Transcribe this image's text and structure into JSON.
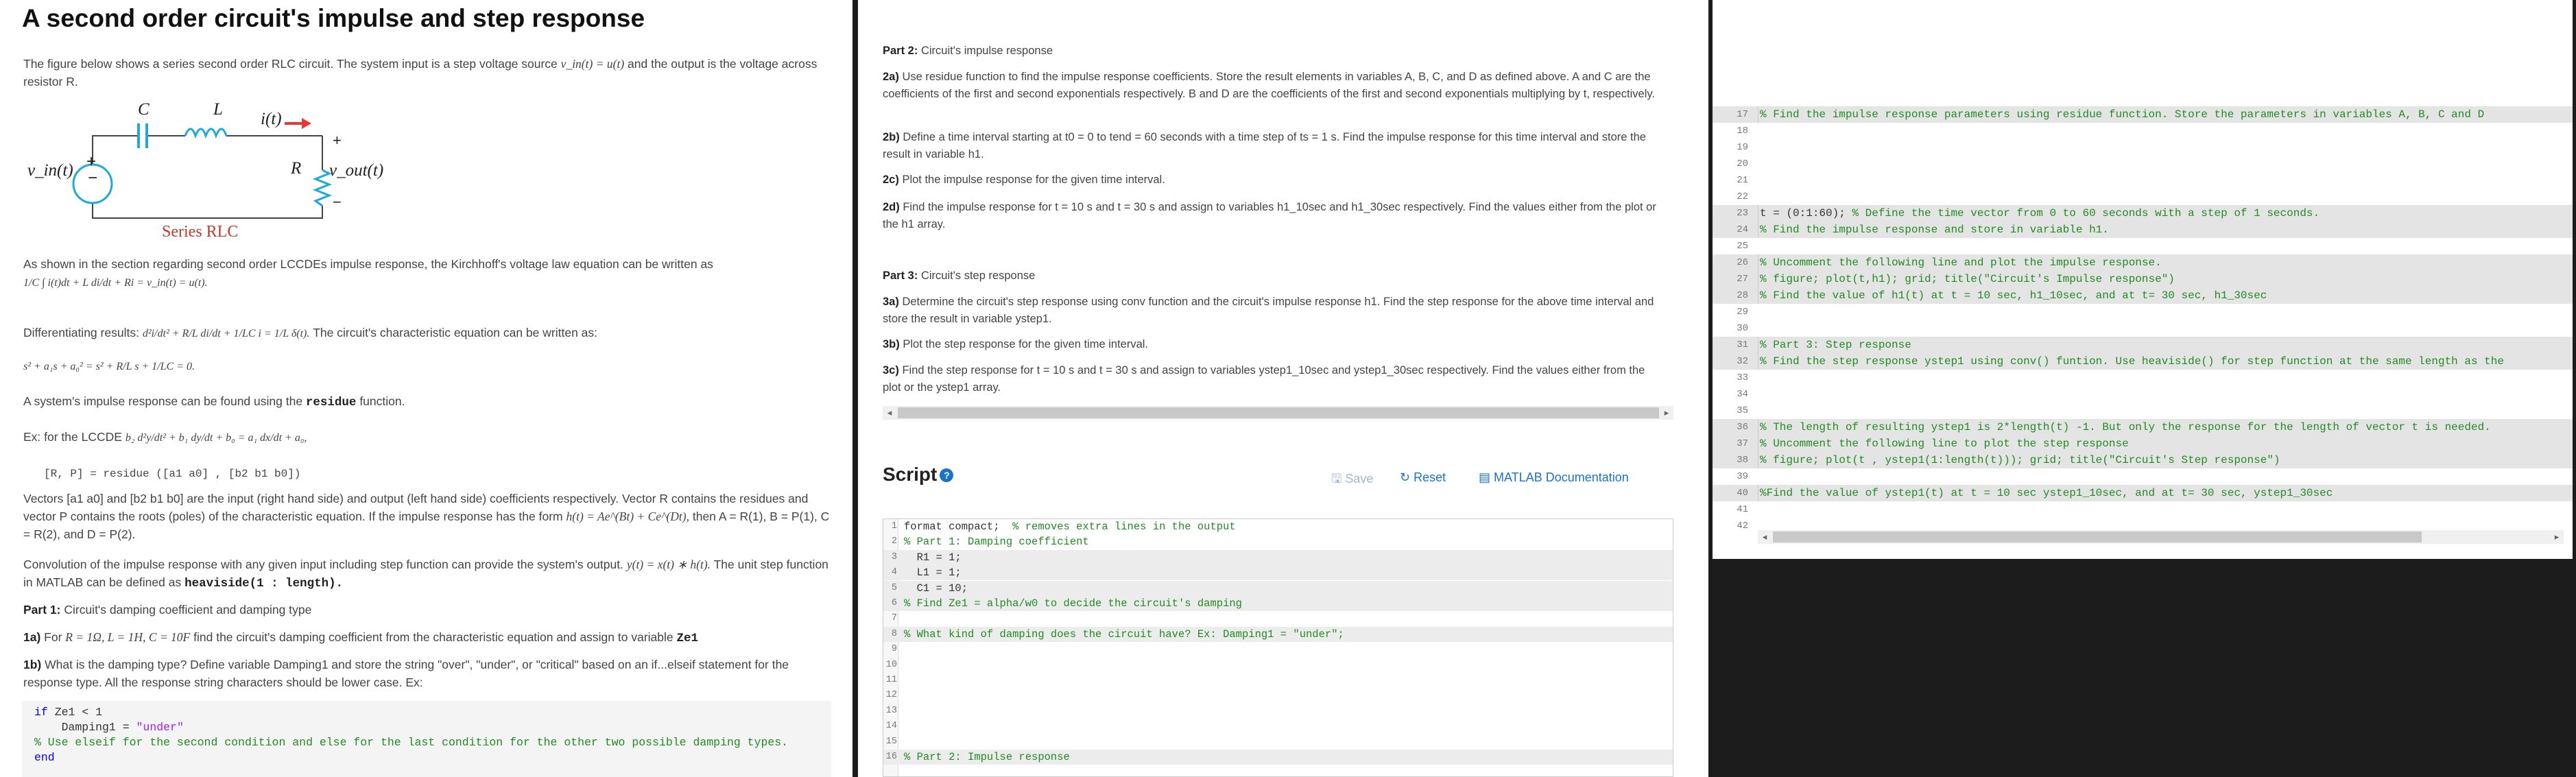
{
  "left": {
    "title": "A second order circuit's impulse and step response",
    "intro": "The figure below shows a series second order RLC circuit. The system input is a step voltage source",
    "intro_math": "v_in(t) = u(t)",
    "intro_tail": "and the output is the voltage across resistor R.",
    "circuit": {
      "C": "C",
      "L": "L",
      "i": "i(t)",
      "R": "R",
      "vin": "v_in(t)",
      "vout": "v_out(t)",
      "plus": "+",
      "minus": "−",
      "caption": "Series RLC"
    },
    "kvl_text": "As shown in the section regarding second order LCCDEs impulse response, the Kirchhoff's voltage law equation can be written as",
    "kvl_eq": "1/C ∫ i(t)dt + L di/dt + Ri = v_in(t) = u(t).",
    "diff_text": "Differentiating results:",
    "diff_eq": "d²i/dt² + R/L di/dt + 1/LC i = 1/L δ(t).",
    "diff_tail": "The circuit's characteristic equation can be written as:",
    "char_eq": "s² + a₁s + a₀² = s² + R/L s + 1/LC = 0.",
    "impulse_text": "A system's impulse response can be found using the",
    "impulse_fn": "residue",
    "impulse_tail": "function.",
    "ex_text": "Ex: for the LCCDE",
    "ex_eq": "b₂ d²y/dt² + b₁ dy/dt + b₀ = a₁ dx/dt + a₀,",
    "residue_code": "[R, P] = residue ([a1 a0] , [b2 b1 b0])",
    "vec_text": "Vectors [a1 a0] and [b2 b1 b0] are the input (right hand side) and output (left hand side) coefficients respectively. Vector R contains the residues and vector P contains the roots (poles) of the characteristic equation. If the impulse response has the form",
    "vec_form": "h(t) = Ae^(Bt) + Ce^(Dt),",
    "vec_then": "then A = R(1), B = P(1), C = R(2), and D = P(2).",
    "conv_text": "Convolution of the impulse response with any given input including step function can provide the system's output.",
    "conv_eq": "y(t) = x(t) ∗ h(t).",
    "conv_tail": "The unit step function in MATLAB can be defined as",
    "heaviside": "heaviside(1 : length).",
    "part1": "Part 1:",
    "part1_title": "Circuit's damping coefficient and damping type",
    "q1a_label": "1a)",
    "q1a": "For",
    "q1a_math": "R = 1Ω, L = 1H, C = 10F",
    "q1a_tail": "find the circuit's damping coefficient from the characteristic equation and assign to variable",
    "q1a_var": "Ze1",
    "q1b_label": "1b)",
    "q1b": "What is the damping type? Define variable Damping1 and store the string \"over\", \"under\", or \"critical\" based on an if...elseif statement for the response type. All the response string characters should be lower case. Ex:",
    "code": [
      {
        "kw": "if",
        "rest": " Ze1 < 1"
      },
      {
        "indent": "    Damping1 = ",
        "str": "\"under\""
      },
      {
        "cm": "% Use elseif for the second condition and else for the last condition for the other two possible damping types."
      },
      {
        "kw": "end"
      }
    ]
  },
  "mid": {
    "part2": "Part 2:",
    "part2_title": "Circuit's impulse response",
    "q2a_label": "2a)",
    "q2a": "Use residue function to find the impulse response coefficients. Store the result elements in variables A, B, C, and D as defined above. A and C are the coefficients of the first and second exponentials respectively. B and D are the coefficients of the first and second exponentials multiplying by t, respectively.",
    "q2b_label": "2b)",
    "q2b": "Define a time interval starting at t0 = 0 to tend = 60 seconds with a time step of ts = 1 s. Find the impulse response for this time interval and store the result in variable h1.",
    "q2c_label": "2c)",
    "q2c": "Plot the impulse response for the given time interval.",
    "q2d_label": "2d)",
    "q2d": "Find the impulse response for t = 10 s and t = 30 s and assign to variables h1_10sec and h1_30sec respectively. Find the values either from the plot or the h1 array.",
    "part3": "Part 3:",
    "part3_title": "Circuit's step response",
    "q3a_label": "3a)",
    "q3a": "Determine the circuit's step response using conv function and the circuit's impulse response h1. Find the step response for the above time interval and store the result in variable ystep1.",
    "q3b_label": "3b)",
    "q3b": "Plot the step response for the given time interval.",
    "q3c_label": "3c)",
    "q3c": "Find the step response for t = 10 s and t = 30 s and assign to variables ystep1_10sec and ystep1_30sec respectively. Find the values either from the plot or the ystep1 array.",
    "script_title": "Script",
    "help_icon": "?",
    "save": "Save",
    "reset": "Reset",
    "docs": "MATLAB Documentation",
    "lines": [
      {
        "n": "1",
        "code": "format compact;",
        "cm": "  % removes extra lines in the output"
      },
      {
        "n": "2",
        "cm": "% Part 1: Damping coefficient"
      },
      {
        "n": "3",
        "code": "  R1 = 1;",
        "gray": true
      },
      {
        "n": "4",
        "code": "  L1 = 1;",
        "gray": true
      },
      {
        "n": "5",
        "code": "  C1 = 10;",
        "gray": true
      },
      {
        "n": "6",
        "cm": "% Find Ze1 = alpha/w0 to decide the circuit's damping",
        "gray": true
      },
      {
        "n": "7"
      },
      {
        "n": "8",
        "cm": "% What kind of damping does the circuit have? Ex: Damping1 = \"under\";",
        "gray": true
      },
      {
        "n": "9"
      },
      {
        "n": "10"
      },
      {
        "n": "11"
      },
      {
        "n": "12"
      },
      {
        "n": "13"
      },
      {
        "n": "14"
      },
      {
        "n": "15"
      },
      {
        "n": "16",
        "cm": "% Part 2: Impulse response",
        "gray": true
      }
    ]
  },
  "right": {
    "lines": [
      {
        "n": "17",
        "cm": "% Find the impulse response parameters using residue function. Store the parameters in variables A, B, C and D",
        "gray": true
      },
      {
        "n": "18"
      },
      {
        "n": "19"
      },
      {
        "n": "20"
      },
      {
        "n": "21"
      },
      {
        "n": "22"
      },
      {
        "n": "23",
        "code": "t = (0:1:60); ",
        "cm": "% Define the time vector from 0 to 60 seconds with a step of 1 seconds.",
        "gray": true
      },
      {
        "n": "24",
        "cm": "% Find the impulse response and store in variable h1.",
        "gray": true
      },
      {
        "n": "25"
      },
      {
        "n": "26",
        "cm": "% Uncomment the following line and plot the impulse response.",
        "gray": true
      },
      {
        "n": "27",
        "cm": "% figure; plot(t,h1); grid; title(\"Circuit's Impulse response\")",
        "gray": true
      },
      {
        "n": "28",
        "cm": "% Find the value of h1(t) at t = 10 sec, h1_10sec, and at t= 30 sec, h1_30sec",
        "gray": true
      },
      {
        "n": "29"
      },
      {
        "n": "30"
      },
      {
        "n": "31",
        "cm": "% Part 3: Step response",
        "gray": true
      },
      {
        "n": "32",
        "cm": "% Find the step response ystep1 using conv() funtion. Use heaviside() for step function at the same length as the",
        "gray": true
      },
      {
        "n": "33"
      },
      {
        "n": "34"
      },
      {
        "n": "35"
      },
      {
        "n": "36",
        "cm": "% The length of resulting ystep1 is 2*length(t) -1. But only the response for the length of vector t is needed.",
        "gray": true
      },
      {
        "n": "37",
        "cm": "% Uncomment the following line to plot the step response",
        "gray": true
      },
      {
        "n": "38",
        "cm": "% figure; plot(t , ystep1(1:length(t))); grid; title(\"Circuit's Step response\")",
        "gray": true
      },
      {
        "n": "39"
      },
      {
        "n": "40",
        "cm": "%Find the value of ystep1(t) at t = 10 sec ystep1_10sec, and at t= 30 sec, ystep1_30sec",
        "gray": true
      },
      {
        "n": "41"
      },
      {
        "n": "42"
      }
    ]
  },
  "colors": {
    "accent": "#1a73c9",
    "comment": "#228b22",
    "keyword": "#0000ff",
    "string": "#a020f0",
    "caption": "#c0392b",
    "source": "#1fa9d6"
  }
}
